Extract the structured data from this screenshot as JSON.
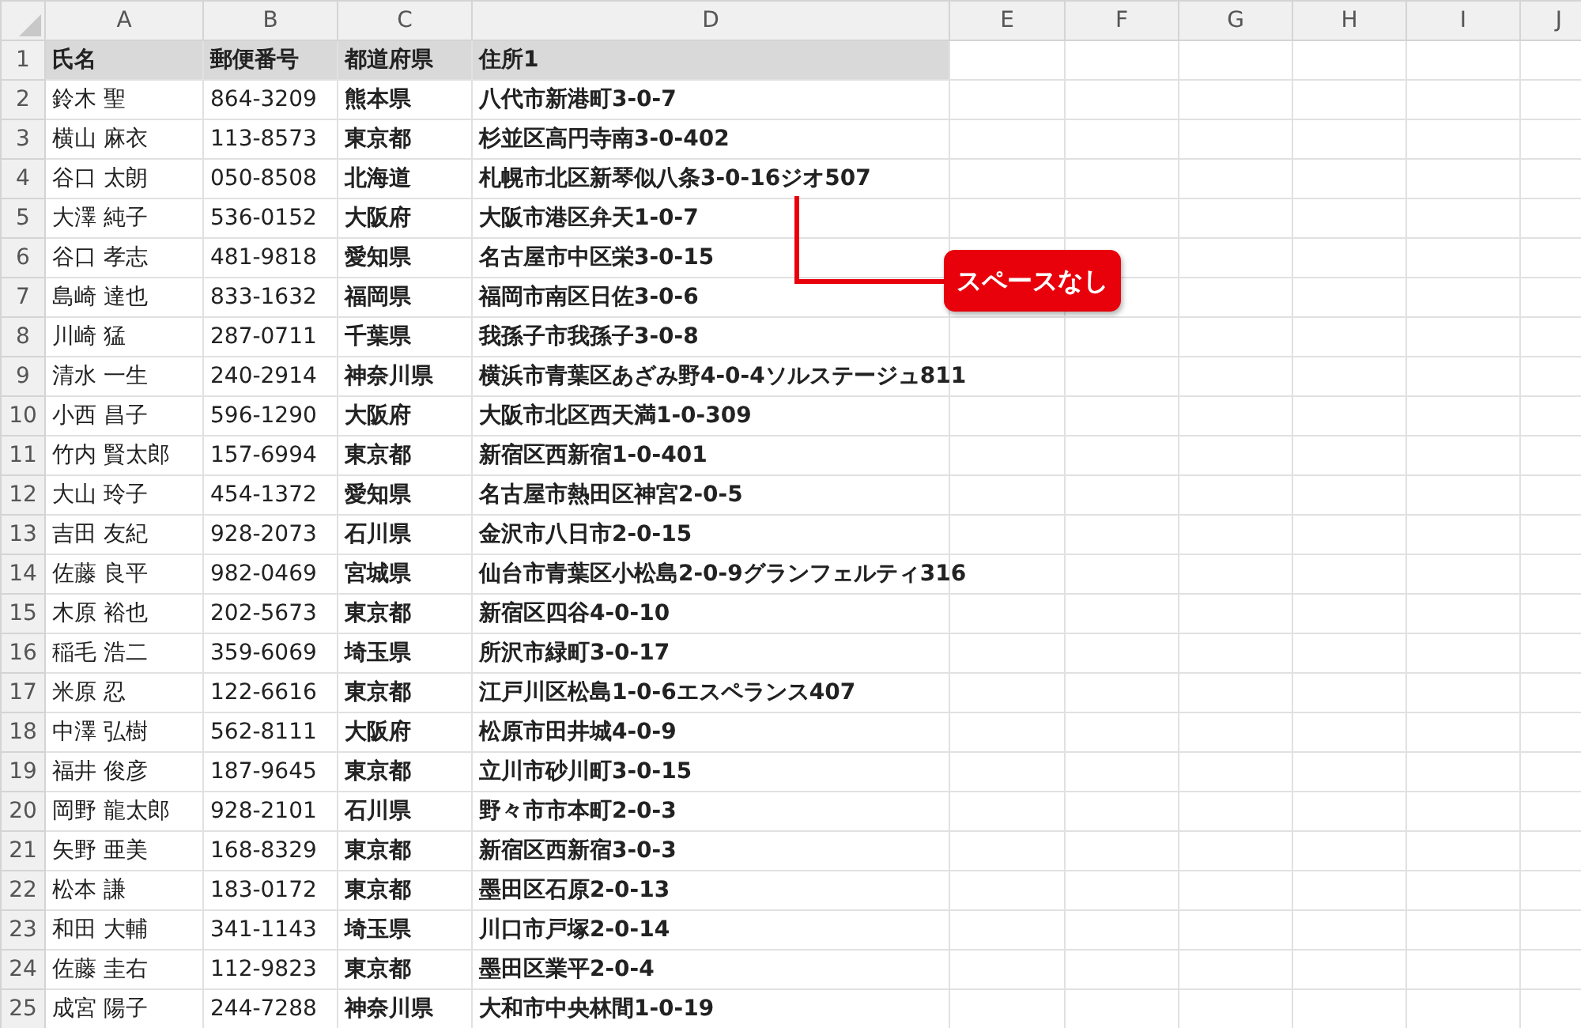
{
  "columns": [
    "A",
    "B",
    "C",
    "D",
    "E",
    "F",
    "G",
    "H",
    "I",
    "J"
  ],
  "header_row": {
    "number": "1",
    "cells": [
      "氏名",
      "郵便番号",
      "都道府県",
      "住所1"
    ]
  },
  "rows": [
    {
      "number": "2",
      "cells": [
        "鈴木 聖",
        "864-3209",
        "熊本県",
        "八代市新港町3-0-7"
      ]
    },
    {
      "number": "3",
      "cells": [
        "横山 麻衣",
        "113-8573",
        "東京都",
        "杉並区高円寺南3-0-402"
      ]
    },
    {
      "number": "4",
      "cells": [
        "谷口 太朗",
        "050-8508",
        "北海道",
        "札幌市北区新琴似八条3-0-16ジオ507"
      ]
    },
    {
      "number": "5",
      "cells": [
        "大澤 純子",
        "536-0152",
        "大阪府",
        "大阪市港区弁天1-0-7"
      ]
    },
    {
      "number": "6",
      "cells": [
        "谷口 孝志",
        "481-9818",
        "愛知県",
        "名古屋市中区栄3-0-15"
      ]
    },
    {
      "number": "7",
      "cells": [
        "島崎 達也",
        "833-1632",
        "福岡県",
        "福岡市南区日佐3-0-6"
      ]
    },
    {
      "number": "8",
      "cells": [
        "川崎 猛",
        "287-0711",
        "千葉県",
        "我孫子市我孫子3-0-8"
      ]
    },
    {
      "number": "9",
      "cells": [
        "清水 一生",
        "240-2914",
        "神奈川県",
        "横浜市青葉区あざみ野4-0-4ソルステージュ811"
      ]
    },
    {
      "number": "10",
      "cells": [
        "小西 昌子",
        "596-1290",
        "大阪府",
        "大阪市北区西天満1-0-309"
      ]
    },
    {
      "number": "11",
      "cells": [
        "竹内 賢太郎",
        "157-6994",
        "東京都",
        "新宿区西新宿1-0-401"
      ]
    },
    {
      "number": "12",
      "cells": [
        "大山 玲子",
        "454-1372",
        "愛知県",
        "名古屋市熱田区神宮2-0-5"
      ]
    },
    {
      "number": "13",
      "cells": [
        "吉田 友紀",
        "928-2073",
        "石川県",
        "金沢市八日市2-0-15"
      ]
    },
    {
      "number": "14",
      "cells": [
        "佐藤 良平",
        "982-0469",
        "宮城県",
        "仙台市青葉区小松島2-0-9グランフェルティ316"
      ]
    },
    {
      "number": "15",
      "cells": [
        "木原 裕也",
        "202-5673",
        "東京都",
        "新宿区四谷4-0-10"
      ]
    },
    {
      "number": "16",
      "cells": [
        "稲毛 浩二",
        "359-6069",
        "埼玉県",
        "所沢市緑町3-0-17"
      ]
    },
    {
      "number": "17",
      "cells": [
        "米原 忍",
        "122-6616",
        "東京都",
        "江戸川区松島1-0-6エスペランス407"
      ]
    },
    {
      "number": "18",
      "cells": [
        "中澤 弘樹",
        "562-8111",
        "大阪府",
        "松原市田井城4-0-9"
      ]
    },
    {
      "number": "19",
      "cells": [
        "福井 俊彦",
        "187-9645",
        "東京都",
        "立川市砂川町3-0-15"
      ]
    },
    {
      "number": "20",
      "cells": [
        "岡野 龍太郎",
        "928-2101",
        "石川県",
        "野々市市本町2-0-3"
      ]
    },
    {
      "number": "21",
      "cells": [
        "矢野 亜美",
        "168-8329",
        "東京都",
        "新宿区西新宿3-0-3"
      ]
    },
    {
      "number": "22",
      "cells": [
        "松本 謙",
        "183-0172",
        "東京都",
        "墨田区石原2-0-13"
      ]
    },
    {
      "number": "23",
      "cells": [
        "和田 大輔",
        "341-1143",
        "埼玉県",
        "川口市戸塚2-0-14"
      ]
    },
    {
      "number": "24",
      "cells": [
        "佐藤 圭右",
        "112-9823",
        "東京都",
        "墨田区業平2-0-4"
      ]
    },
    {
      "number": "25",
      "cells": [
        "成宮 陽子",
        "244-7288",
        "神奈川県",
        "大和市中央林間1-0-19"
      ]
    }
  ],
  "callout": {
    "text": "スペースなし"
  }
}
